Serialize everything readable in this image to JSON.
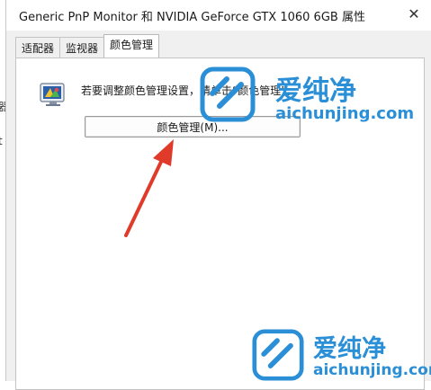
{
  "window": {
    "title": "Generic PnP Monitor 和 NVIDIA GeForce GTX 1060 6GB 属性",
    "close_glyph": "✕"
  },
  "tabs": [
    {
      "label": "适配器",
      "active": false
    },
    {
      "label": "监视器",
      "active": false
    },
    {
      "label": "颜色管理",
      "active": true
    }
  ],
  "color_management": {
    "icon": "monitor-color-icon",
    "info_text": "若要调整颜色管理设置，请单击“颜色管理”。",
    "button_label": "颜色管理(M)..."
  },
  "background_window": {
    "edge_chars": [
      "器",
      "t"
    ]
  },
  "annotation": {
    "arrow_color": "#e03a2a"
  },
  "watermark": {
    "brand_cn": "爱纯净",
    "brand_url": "aichunjing.com",
    "color": "#2a8fd6"
  }
}
